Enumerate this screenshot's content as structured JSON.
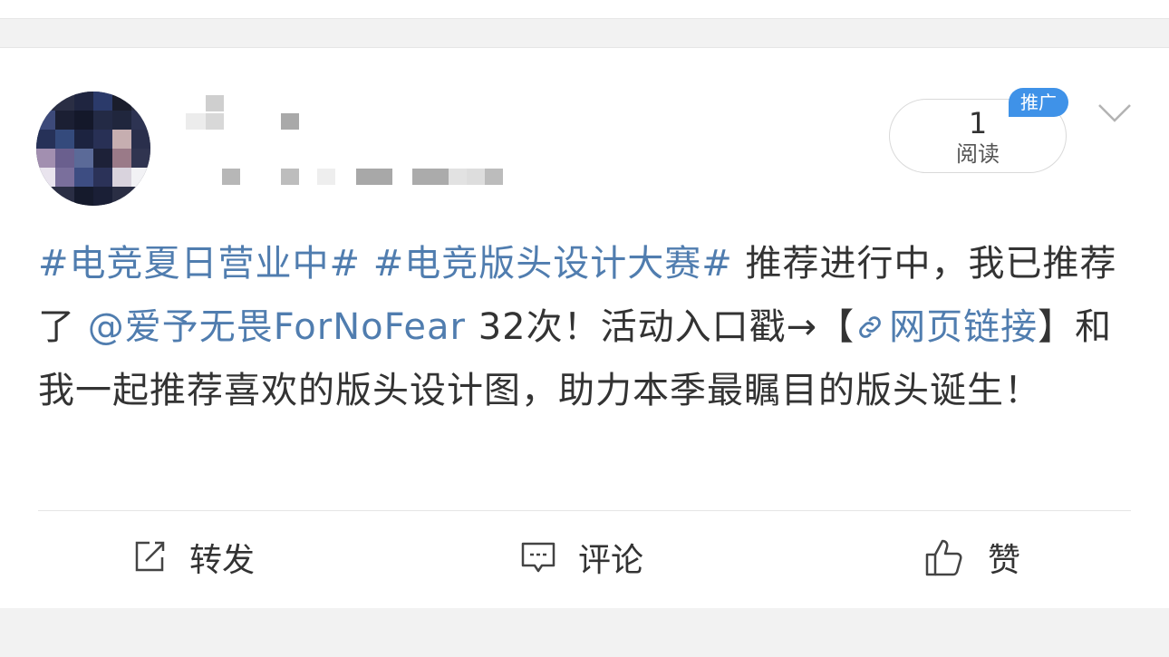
{
  "post": {
    "topic1": "#电竞夏日营业中#",
    "topic2": "#电竞版头设计大赛#",
    "text1": " 推荐进行中，我已推荐了 ",
    "mention": "@爱予无畏ForNoFear",
    "text2": " 32次！活动入口戳→",
    "bracket_open": "【",
    "link_icon": "link-icon",
    "link_text": "网页链接",
    "bracket_close": "】",
    "text3": "和我一起推荐喜欢的版头设计图，助力本季最瞩目的版头诞生！"
  },
  "read_badge": {
    "count": "1",
    "label": "阅读",
    "promo_tag": "推广"
  },
  "actions": {
    "repost": {
      "label": "转发",
      "icon": "edit-share-icon"
    },
    "comment": {
      "label": "评论",
      "icon": "comment-icon"
    },
    "like": {
      "label": "赞",
      "icon": "thumbs-up-icon"
    }
  },
  "colors": {
    "link": "#507daf",
    "text": "#333333",
    "promo": "#3f92e8",
    "background": "#f2f2f2"
  }
}
